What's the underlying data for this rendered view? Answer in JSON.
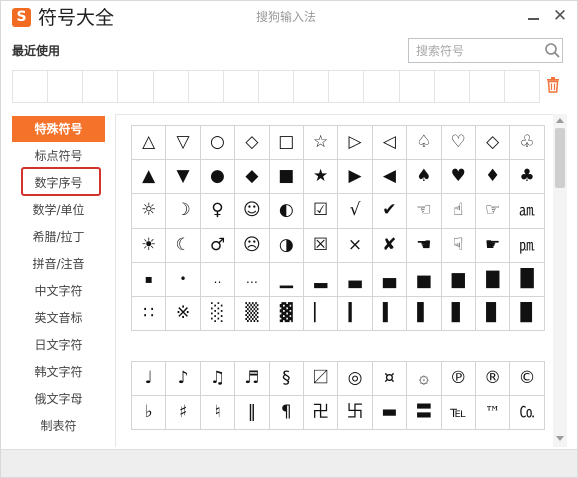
{
  "header": {
    "app_title": "符号大全",
    "center_title": "搜狗输入法",
    "minimize_icon": "minimize-icon",
    "close_label": "✕"
  },
  "recent": {
    "label": "最近使用",
    "slots": [
      "",
      "",
      "",
      "",
      "",
      "",
      "",
      "",
      "",
      "",
      "",
      "",
      "",
      "",
      ""
    ],
    "trash_icon": "trash-icon"
  },
  "search": {
    "placeholder": "搜索符号",
    "value": "",
    "icon": "search-icon"
  },
  "sidebar": {
    "active_index": 0,
    "highlighted_index": 2,
    "items": [
      {
        "label": "特殊符号"
      },
      {
        "label": "标点符号"
      },
      {
        "label": "数字序号"
      },
      {
        "label": "数学/单位"
      },
      {
        "label": "希腊/拉丁"
      },
      {
        "label": "拼音/注音"
      },
      {
        "label": "中文字符"
      },
      {
        "label": "英文音标"
      },
      {
        "label": "日文字符"
      },
      {
        "label": "韩文字符"
      },
      {
        "label": "俄文字母"
      },
      {
        "label": "制表符"
      }
    ]
  },
  "symbols": {
    "group1": [
      "△",
      "▽",
      "○",
      "◇",
      "□",
      "☆",
      "▷",
      "◁",
      "♤",
      "♡",
      "◇",
      "♧",
      "▲",
      "▼",
      "●",
      "◆",
      "■",
      "★",
      "▶",
      "◀",
      "♠",
      "♥",
      "♦",
      "♣",
      "☼",
      "☽",
      "♀",
      "☺",
      "◐",
      "☑",
      "√",
      "✔",
      "☜",
      "☝",
      "☞",
      "㏂",
      "☀",
      "☾",
      "♂",
      "☹",
      "◑",
      "☒",
      "×",
      "✘",
      "☚",
      "☟",
      "☛",
      "㏘",
      "▪",
      "•",
      "‥",
      "…",
      "▁",
      "▂",
      "▃",
      "▄",
      "▅",
      "▆",
      "▇",
      "█",
      "∷",
      "※",
      "░",
      "▒",
      "▓",
      "▏",
      "▎",
      "▍",
      "▌",
      "▋",
      "▊",
      "▉"
    ],
    "group2": [
      "♩",
      "♪",
      "♫",
      "♬",
      "§",
      "〼",
      "◎",
      "¤",
      "۞",
      "℗",
      "®",
      "©",
      "♭",
      "♯",
      "♮",
      "‖",
      "¶",
      "卍",
      "卐",
      "▬",
      "〓",
      "℡",
      "™",
      "㏇"
    ]
  },
  "colors": {
    "accent": "#f5722b",
    "highlight_border": "#d2322b",
    "logo": "#f26b22"
  }
}
